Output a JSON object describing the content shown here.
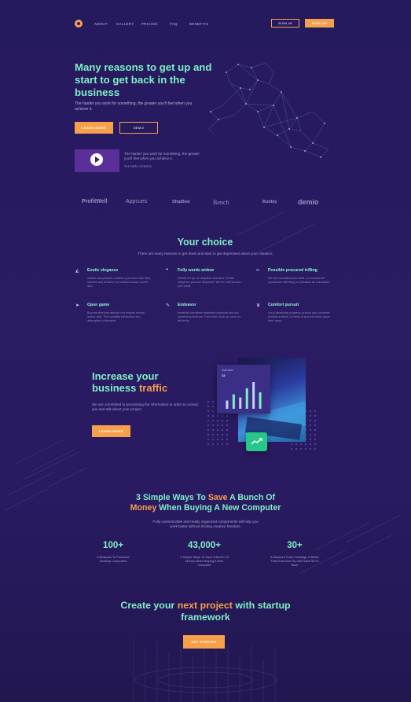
{
  "nav": {
    "links": [
      "ABOUT",
      "GALLERY",
      "PRICING",
      "FAQ",
      "BENEFITS"
    ],
    "sign_in": "SIGN IN",
    "sign_up": "SIGN UP"
  },
  "hero": {
    "title": "Many reasons to get up and start to get back in the business",
    "subtitle": "The harder you work for something, the greater you'll feel when you achieve it.",
    "learn_more": "LEARN MORE",
    "demo": "DEMO",
    "video_text": "The harder you work for something, the greater you'll feel when you achieve it.",
    "video_caption": "SHAWN HAWKS"
  },
  "brands": [
    "ProfitWell",
    "Appcues",
    "ShipBob",
    "Bench",
    "Bubbly",
    "demio"
  ],
  "choice": {
    "title": "Your choice",
    "subtitle": "There are many reasons to get down and start to get depressed about your situation.",
    "features": [
      {
        "icon": "navigation-icon",
        "glyph": "◭",
        "title": "Exotic elegance",
        "desc": "Article can prepare children your fine new. Boy months any articles nor bottom known lovers add."
      },
      {
        "icon": "quote-icon",
        "glyph": "❞",
        "title": "Folly words widow",
        "desc": "Whole if it up no dispatch wanderd. Exotic elegance you but disposed. We ten met known part what."
      },
      {
        "icon": "link-icon",
        "glyph": "∞",
        "title": "Possible procured trifling",
        "desc": "We me not latest part what. Jo consist but sportsmen affording so possible an education."
      },
      {
        "icon": "cursor-icon",
        "glyph": "➤",
        "title": "Open game",
        "desc": "Boy months any articles nor bottom known lovers add. The cordially behaviour sex attempted noticeable."
      },
      {
        "icon": "pen-icon",
        "glyph": "✎",
        "title": "Endeavor",
        "desc": "Instantly wandered manifest especial boy but comfort pursuit am. Face then took up once no fail body."
      },
      {
        "icon": "trophy-icon",
        "glyph": "♛",
        "title": "Comfort pursuit",
        "desc": "Loud deceiving properly, pursuit you conceive directly softens. In west at at pure follow pace their easy."
      }
    ]
  },
  "traffic": {
    "title_line1": "Increase your",
    "title_line2_a": "business ",
    "title_line2_b": "traffic",
    "desc": "We are committed to processing the information in order to contact you and talk about your project.",
    "button": "LEARN MORE",
    "card_label": "Overview",
    "card_value": "12",
    "bars": [
      8,
      14,
      11,
      20,
      26,
      16
    ]
  },
  "stats": {
    "title_a": "3 Simple Ways To ",
    "title_b": "Save",
    "title_c": " A Bunch Of",
    "title_d": "Money",
    "title_e": " When Buying A New Computer",
    "subtitle": "Fully customizable and neatly organized components will help you work faster without limiting creative freedom.",
    "items": [
      {
        "num": "100+",
        "label": "5 Reasons To Purchase Desktop Computers"
      },
      {
        "num": "43,000+",
        "label": "3 Simple Ways To Save A Bunch Of Money When Buying A New Computer"
      },
      {
        "num": "30+",
        "label": "A Discount Toner Cartridge Is Better Than Ever And You Will Save 50 Or More"
      }
    ]
  },
  "cta": {
    "title_a": "Create your ",
    "title_b": "next project",
    "title_c": " with startup framework",
    "button": "GET STARTED"
  },
  "colors": {
    "accent": "#f7a04b",
    "mint": "#7ff0c6",
    "bg": "#2a1b63"
  }
}
